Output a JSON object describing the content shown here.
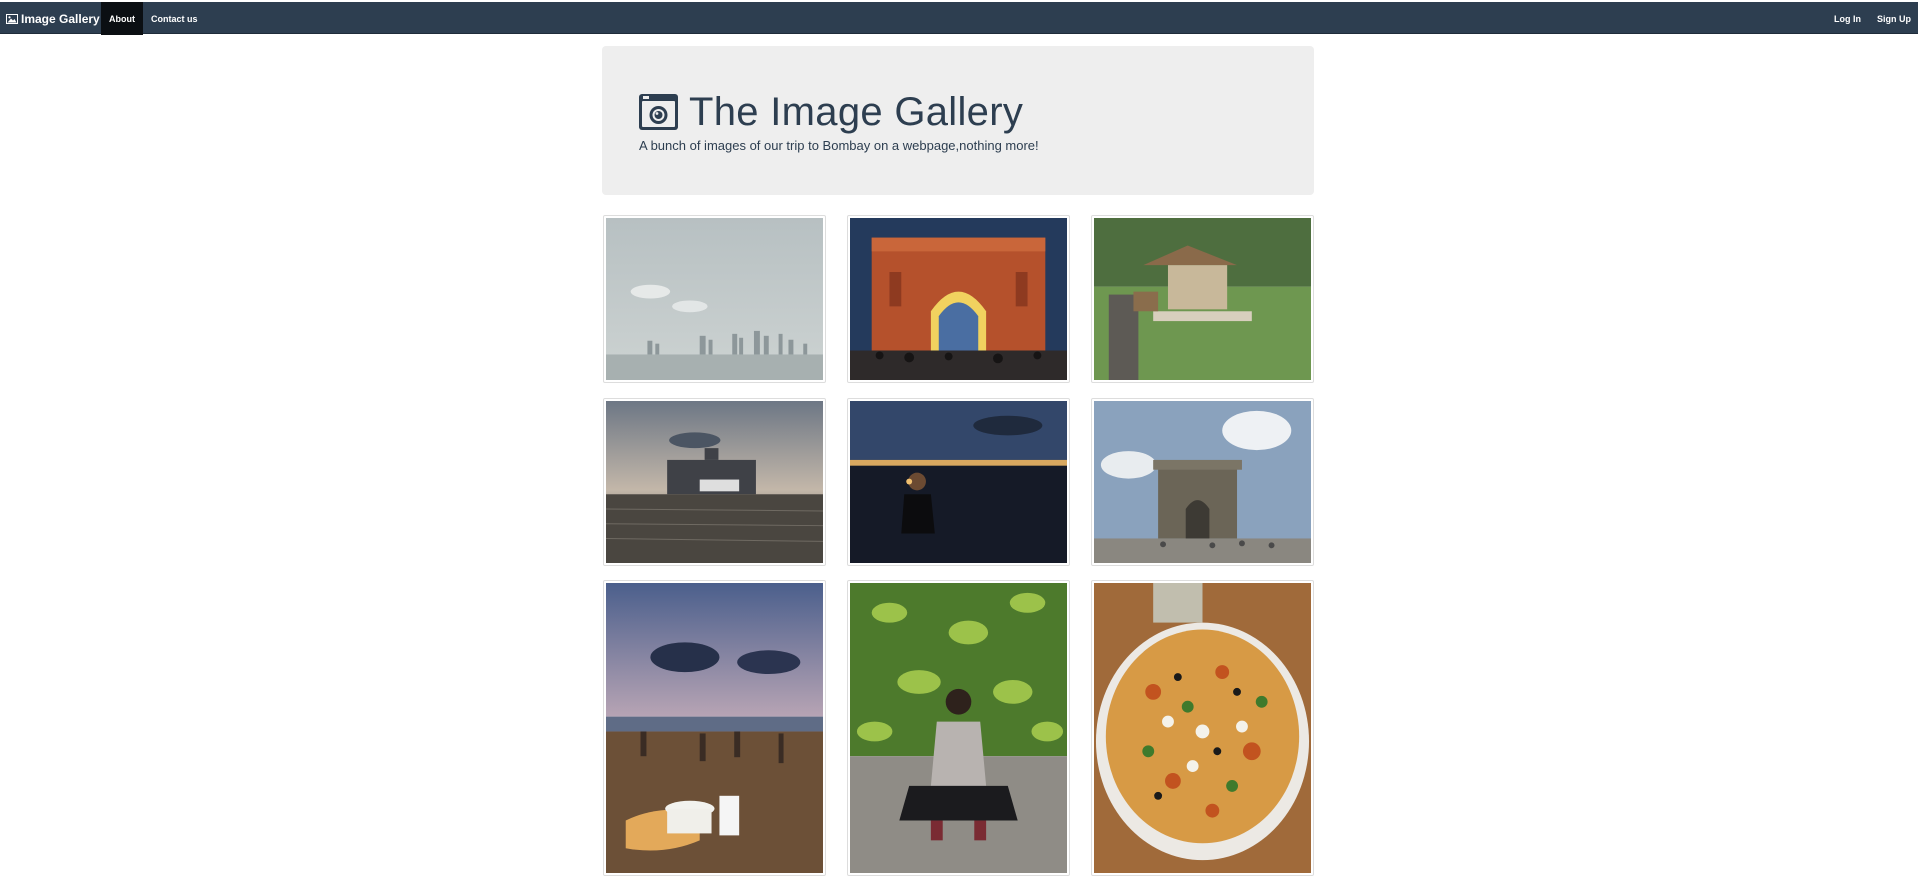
{
  "navbar": {
    "brand": "Image Gallery",
    "brand_icon": "picture-icon",
    "links": [
      "About",
      "Contact us"
    ],
    "right_links": [
      "Log In",
      "Sign Up"
    ]
  },
  "jumbotron": {
    "icon": "camera-icon",
    "title": "The Image Gallery",
    "subtitle": "A bunch of images of our trip to Bombay on a webpage,nothing more!"
  },
  "colors": {
    "navbar": "#2d3e50",
    "active_tab": "#0b0f13",
    "jumbotron_bg": "#eeeeee",
    "title_text": "#2d3e50"
  }
}
